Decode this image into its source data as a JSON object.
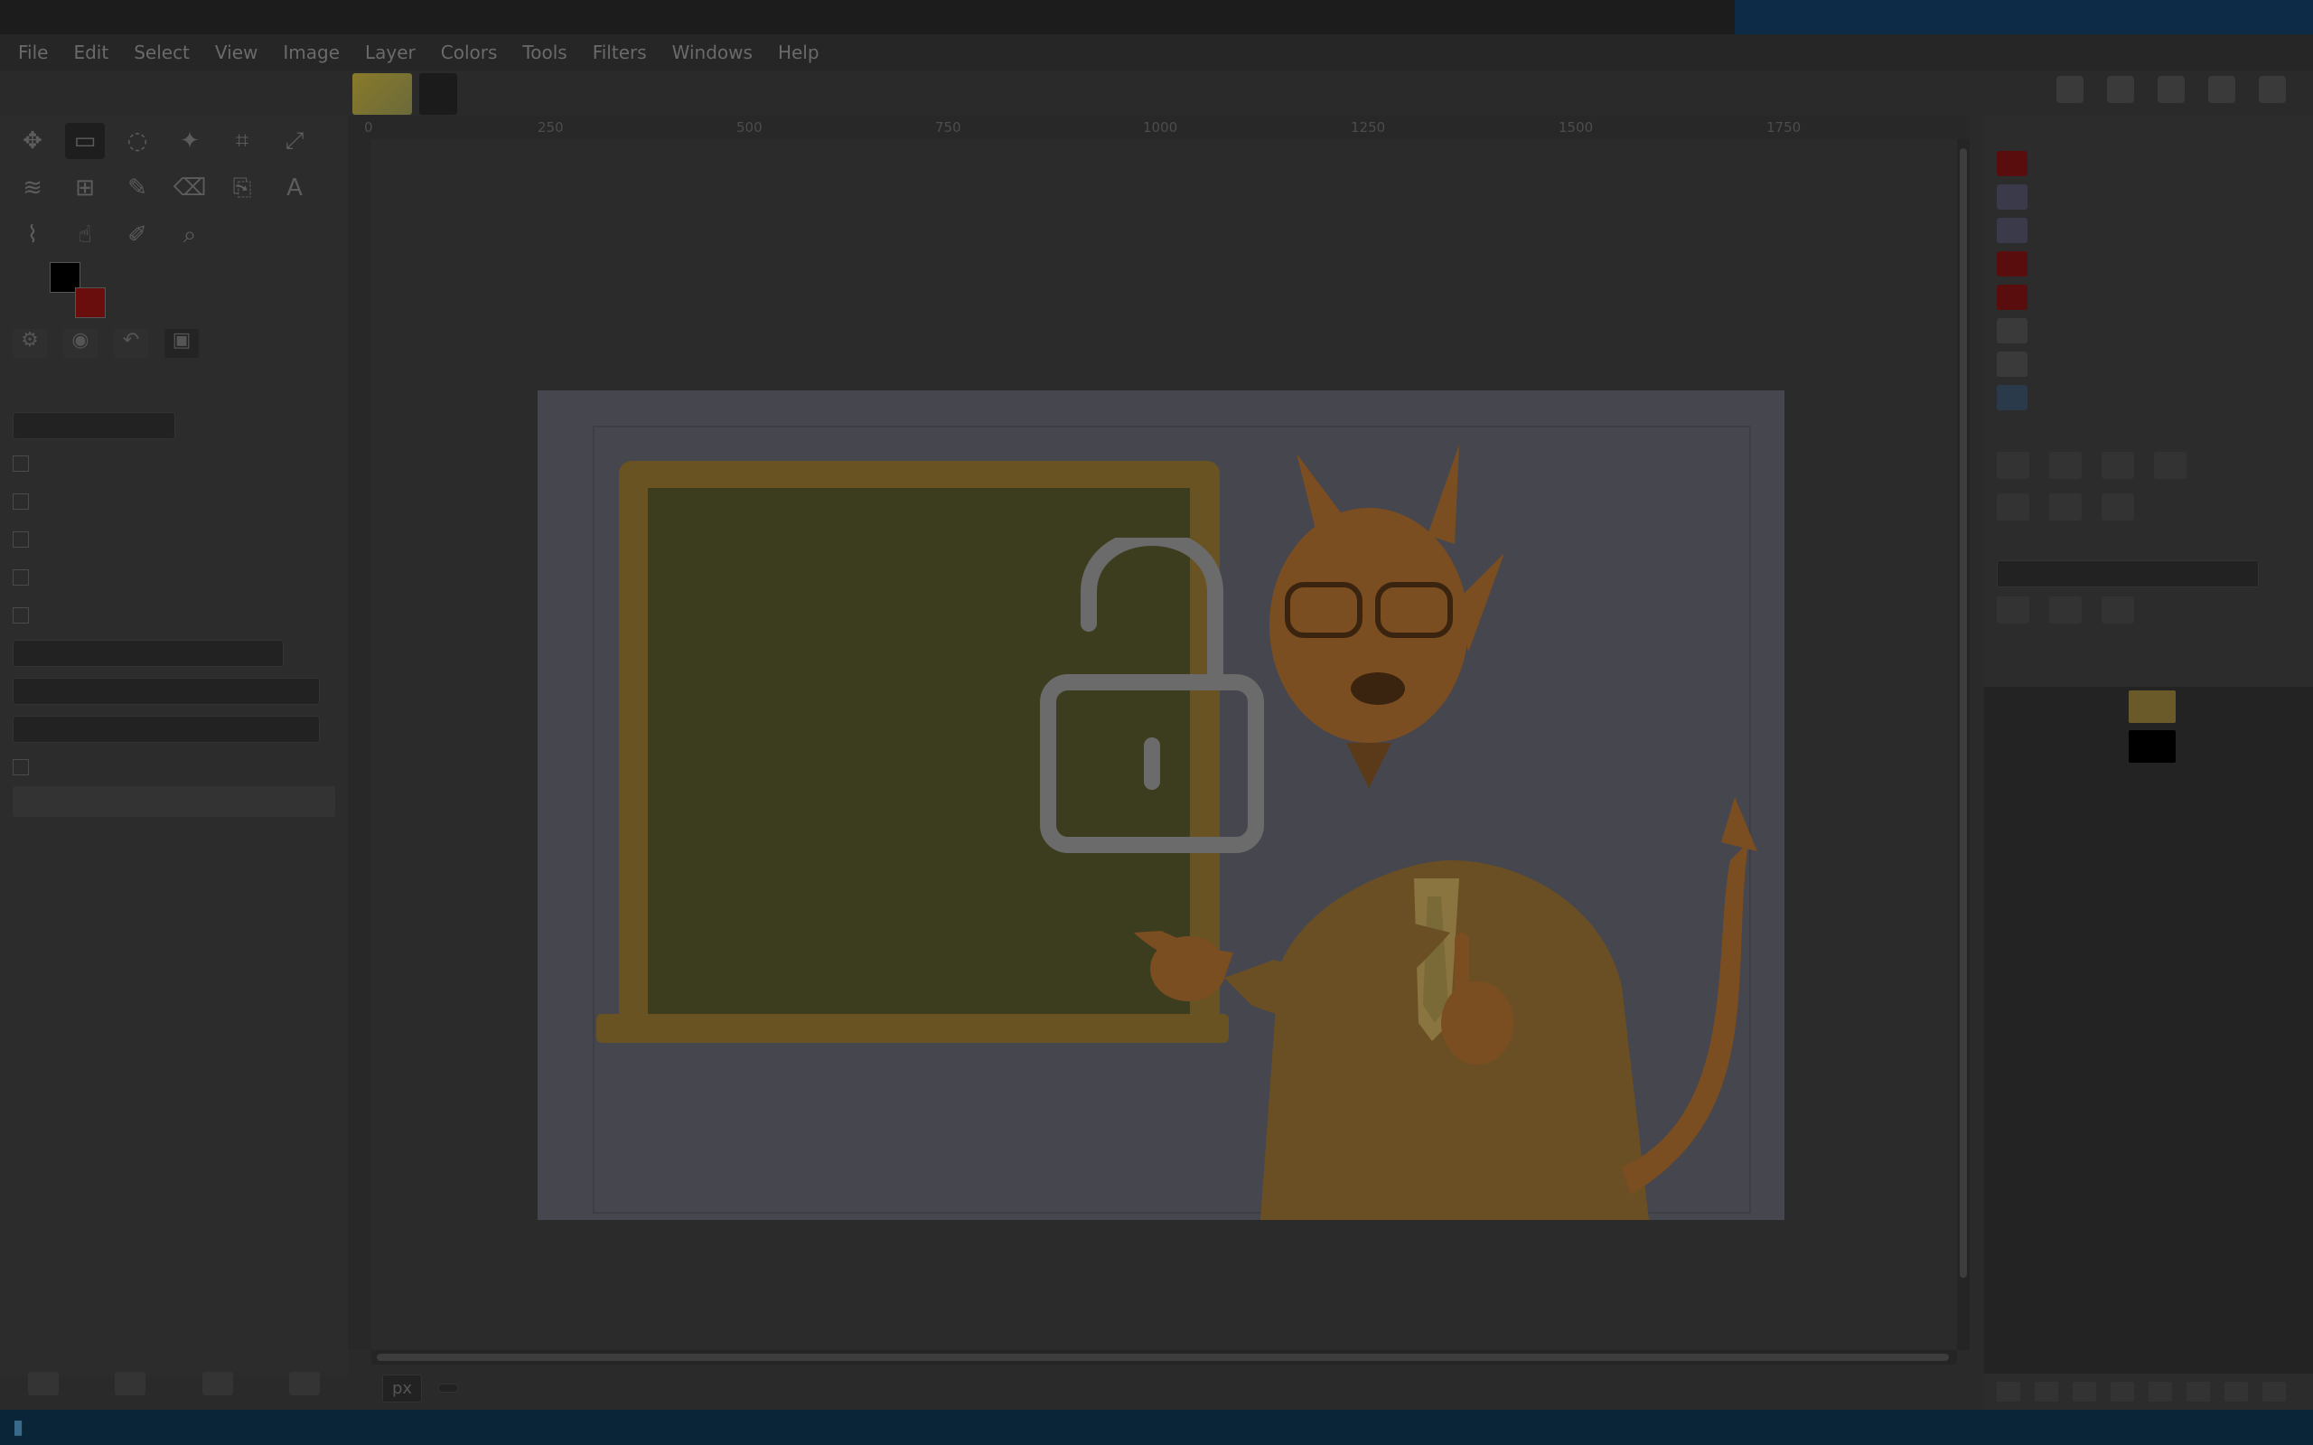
{
  "window": {
    "title_segments": [
      "",
      "",
      "",
      "",
      ""
    ]
  },
  "system_status": [
    "",
    "",
    "",
    "",
    "",
    "",
    ""
  ],
  "menu": [
    "File",
    "Edit",
    "Select",
    "View",
    "Image",
    "Layer",
    "Colors",
    "Tools",
    "Filters",
    "Windows",
    "Help"
  ],
  "toolbox": {
    "tools": [
      "move-icon",
      "select-rect-icon",
      "lasso-icon",
      "fuzzy-select-icon",
      "crop-icon",
      "transform-icon",
      "warp-icon",
      "unified-transform-icon",
      "paintbrush-icon",
      "eraser-icon",
      "clone-icon",
      "text-icon",
      "paths-icon",
      "smudge-icon",
      "color-picker-icon",
      "zoom-icon"
    ],
    "options_title": "",
    "options": [
      "",
      "",
      "",
      "",
      "",
      ""
    ],
    "option_fields": [
      "",
      "",
      "",
      ""
    ],
    "option_button": ""
  },
  "canvas": {
    "ruler_ticks": [
      "0",
      "250",
      "500",
      "750",
      "1000",
      "1250",
      "1500",
      "1750"
    ],
    "lock_state": "unlocked"
  },
  "canvas_status": {
    "unit": "px",
    "zoom": "",
    "message": ""
  },
  "right_dock": {
    "brushes": [
      {
        "name": "",
        "color": "#5a0d0d"
      },
      {
        "name": "",
        "color": "#3a3a4a"
      },
      {
        "name": "",
        "color": "#3a3a4a"
      },
      {
        "name": "",
        "color": "#5a0d0d"
      },
      {
        "name": "",
        "color": "#5a0d0d"
      },
      {
        "name": "",
        "color": "#3a3a3a"
      },
      {
        "name": "",
        "color": "#3a3a3a"
      },
      {
        "name": "",
        "color": "#2a3a4a"
      }
    ],
    "layers_mode_label": "",
    "layers": [
      {
        "name": "",
        "thumb_color": "#6a5a2a"
      },
      {
        "name": "",
        "thumb_color": "#000000"
      }
    ]
  },
  "taskbar": {
    "tray": [
      "",
      "",
      "",
      "",
      "",
      ""
    ]
  }
}
